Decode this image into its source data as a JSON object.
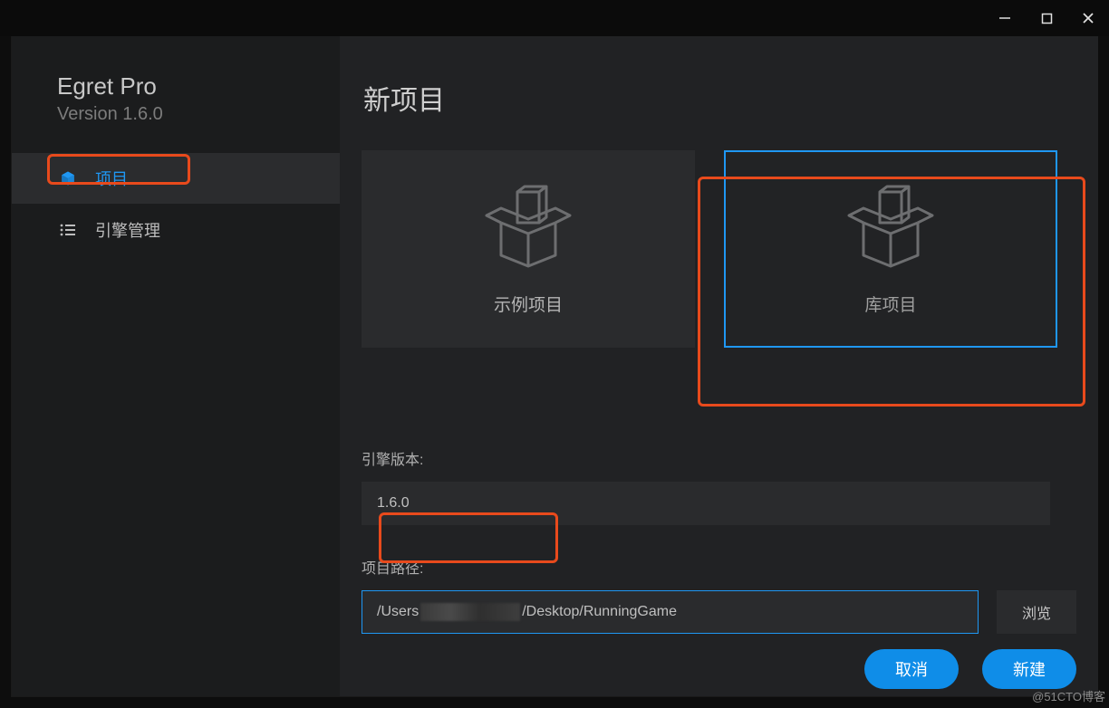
{
  "app": {
    "title": "Egret Pro",
    "version_label": "Version 1.6.0"
  },
  "sidebar": {
    "items": [
      {
        "icon": "cube-icon",
        "label": "项目",
        "active": true
      },
      {
        "icon": "list-icon",
        "label": "引擎管理",
        "active": false
      }
    ]
  },
  "main": {
    "title": "新项目",
    "cards": [
      {
        "label": "示例项目",
        "selected": false
      },
      {
        "label": "库项目",
        "selected": true
      }
    ],
    "engine_version_label": "引擎版本:",
    "engine_version_value": "1.6.0",
    "project_path_label": "项目路径:",
    "project_path_prefix": "/Users",
    "project_path_suffix": "/Desktop/RunningGame",
    "browse_label": "浏览",
    "cancel_label": "取消",
    "create_label": "新建"
  },
  "watermark": "@51CTO博客"
}
